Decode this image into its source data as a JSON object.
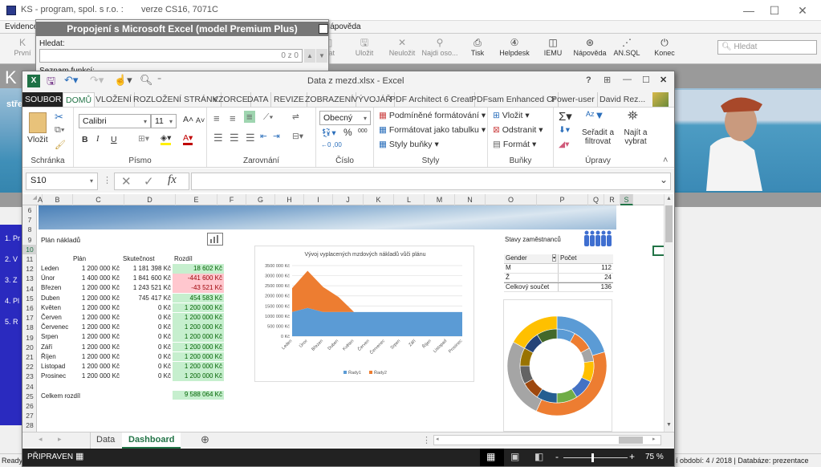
{
  "ks": {
    "title": "KS - program, spol. s r.o. :",
    "version": "verze CS16, 7071C",
    "menu": {
      "evidence": "Evidence",
      "napoveda": "Nápověda"
    },
    "toolbar": [
      {
        "label": "První",
        "icon": "first-icon"
      },
      {
        "label": "Uložit",
        "icon": "save-icon"
      },
      {
        "label": "Neuložit",
        "icon": "discard-icon"
      },
      {
        "label": "Najdi oso...",
        "icon": "search-person-icon"
      },
      {
        "label": "Tisk",
        "icon": "print-icon"
      },
      {
        "label": "Helpdesk",
        "icon": "helpdesk-icon"
      },
      {
        "label": "IEMU",
        "icon": "book-icon"
      },
      {
        "label": "Nápověda",
        "icon": "help-icon"
      },
      {
        "label": "AN.SQL",
        "icon": "sql-icon"
      },
      {
        "label": "Konec",
        "icon": "power-icon"
      }
    ],
    "partial_toolbar_label": "zat",
    "search_placeholder": "Hledat",
    "logo": "K",
    "banner_text": "stře",
    "nav_items": [
      "1. Pr",
      "2. V",
      "3. Z",
      "4. Pl",
      "5. R"
    ],
    "status_left": "Ready",
    "status_right": "í období: 4 / 2018 | Databáze: prezentace"
  },
  "popup": {
    "title": "Propojení s Microsoft Excel (model Premium Plus)",
    "search_label": "Hledat:",
    "search_counter": "0 z 0",
    "list_label": "Seznam funkcí:"
  },
  "excel": {
    "title": "Data z mezd.xlsx - Excel",
    "title_buttons": [
      "?",
      "⊞",
      "—",
      "☐",
      "✕"
    ],
    "tabs": [
      "SOUBOR",
      "DOMŮ",
      "VLOŽENÍ",
      "ROZLOŽENÍ STRÁNK",
      "VZORCE",
      "DATA",
      "REVIZE",
      "ZOBRAZENÍ",
      "VÝVOJÁŘ",
      "PDF Architect 6 Creat",
      "PDFsam Enhanced Cr",
      "Power-user"
    ],
    "active_tab": "DOMŮ",
    "user": "David Rez...",
    "ribbon": {
      "clipboard": {
        "paste": "Vložit",
        "group": "Schránka"
      },
      "font": {
        "name": "Calibri",
        "size": "11",
        "bold": "B",
        "italic": "I",
        "underline": "U",
        "group": "Písmo"
      },
      "alignment": {
        "group": "Zarovnání"
      },
      "number": {
        "format": "Obecný",
        "percent": "%",
        "thousands": "000",
        "group": "Číslo"
      },
      "styles": {
        "conditional": "Podmíněné formátování",
        "as_table": "Formátovat jako tabulku",
        "cell_styles": "Styly buňky",
        "group": "Styly"
      },
      "cells": {
        "insert": "Vložit",
        "delete": "Odstranit",
        "format": "Formát",
        "group": "Buňky"
      },
      "editing": {
        "sort": "Seřadit a filtrovat",
        "find": "Najít a vybrat",
        "group": "Úpravy"
      }
    },
    "name_box": "S10",
    "formula": "",
    "columns": [
      "A",
      "B",
      "C",
      "D",
      "E",
      "F",
      "G",
      "H",
      "I",
      "J",
      "K",
      "L",
      "M",
      "N",
      "O",
      "P",
      "Q",
      "R",
      "S"
    ],
    "rows": [
      "6",
      "7",
      "8",
      "9",
      "10",
      "11",
      "12",
      "13",
      "14",
      "15",
      "16",
      "17",
      "18",
      "19",
      "20",
      "21",
      "22",
      "23",
      "24",
      "25",
      "26",
      "27",
      "28"
    ],
    "plan_title": "Plán nákladů",
    "table_headers": [
      "Plán",
      "Skutečnost",
      "Rozdíl"
    ],
    "table_rows": [
      {
        "month": "Leden",
        "plan": "1 200 000 Kč",
        "actual": "1 181 398 Kč",
        "diff": "18 602 Kč",
        "status": "pos"
      },
      {
        "month": "Únor",
        "plan": "1 400 000 Kč",
        "actual": "1 841 600 Kč",
        "diff": "-441 600 Kč",
        "status": "neg"
      },
      {
        "month": "Březen",
        "plan": "1 200 000 Kč",
        "actual": "1 243 521 Kč",
        "diff": "-43 521 Kč",
        "status": "neg"
      },
      {
        "month": "Duben",
        "plan": "1 200 000 Kč",
        "actual": "745 417 Kč",
        "diff": "454 583 Kč",
        "status": "pos"
      },
      {
        "month": "Květen",
        "plan": "1 200 000 Kč",
        "actual": "0 Kč",
        "diff": "1 200 000 Kč",
        "status": "pos"
      },
      {
        "month": "Červen",
        "plan": "1 200 000 Kč",
        "actual": "0 Kč",
        "diff": "1 200 000 Kč",
        "status": "pos"
      },
      {
        "month": "Červenec",
        "plan": "1 200 000 Kč",
        "actual": "0 Kč",
        "diff": "1 200 000 Kč",
        "status": "pos"
      },
      {
        "month": "Srpen",
        "plan": "1 200 000 Kč",
        "actual": "0 Kč",
        "diff": "1 200 000 Kč",
        "status": "pos"
      },
      {
        "month": "Září",
        "plan": "1 200 000 Kč",
        "actual": "0 Kč",
        "diff": "1 200 000 Kč",
        "status": "pos"
      },
      {
        "month": "Říjen",
        "plan": "1 200 000 Kč",
        "actual": "0 Kč",
        "diff": "1 200 000 Kč",
        "status": "pos"
      },
      {
        "month": "Listopad",
        "plan": "1 200 000 Kč",
        "actual": "0 Kč",
        "diff": "1 200 000 Kč",
        "status": "pos"
      },
      {
        "month": "Prosinec",
        "plan": "1 200 000 Kč",
        "actual": "0 Kč",
        "diff": "1 200 000 Kč",
        "status": "pos"
      }
    ],
    "total_label": "Celkem rozdíl",
    "total_value": "9 588 064 Kč",
    "staff_title": "Stavy zaměstnanců",
    "pivot": {
      "headers": [
        "Gender",
        "Počet"
      ],
      "rows": [
        {
          "k": "M",
          "v": "112"
        },
        {
          "k": "Ž",
          "v": "24"
        },
        {
          "k": "Celkový součet",
          "v": "136"
        }
      ]
    },
    "sheet_tabs": [
      "Data",
      "Dashboard"
    ],
    "active_sheet": "Dashboard",
    "status": "PŘIPRAVEN",
    "zoom": "75 %",
    "zoom_level": 75
  },
  "chart_data": [
    {
      "type": "area",
      "title": "Vývoj vyplacených mzdových nákladů vůči plánu",
      "categories": [
        "Leden",
        "Únor",
        "Březen",
        "Duben",
        "Květen",
        "Červen",
        "Červenec",
        "Srpen",
        "Září",
        "Říjen",
        "Listopad",
        "Prosinec"
      ],
      "series": [
        {
          "name": "Řady1",
          "color": "#5b9bd5",
          "values": [
            1200000,
            1400000,
            1200000,
            1200000,
            1200000,
            1200000,
            1200000,
            1200000,
            1200000,
            1200000,
            1200000,
            1200000
          ]
        },
        {
          "name": "Řady2",
          "color": "#ed7d31",
          "values": [
            1181398,
            1841600,
            1243521,
            745417,
            0,
            0,
            0,
            0,
            0,
            0,
            0,
            0
          ]
        }
      ],
      "stacked": true,
      "y_ticks": [
        "0 Kč",
        "500 000 Kč",
        "1000 000 Kč",
        "1500 000 Kč",
        "2000 000 Kč",
        "2500 000 Kč",
        "3000 000 Kč",
        "3500 000 Kč"
      ],
      "ylim": [
        0,
        3500000
      ],
      "legend": "bottom",
      "grid": true
    },
    {
      "type": "pie",
      "variant": "doughnut",
      "title": "",
      "outer": [
        {
          "color": "#5b9bd5",
          "value": 18
        },
        {
          "color": "#ed7d31",
          "value": 32
        },
        {
          "color": "#a5a5a5",
          "value": 23
        },
        {
          "color": "#ffc000",
          "value": 15
        },
        {
          "color": "#5b9bd5",
          "value": 0
        }
      ],
      "inner": [
        {
          "color": "#5b9bd5",
          "value": 8
        },
        {
          "color": "#ed7d31",
          "value": 9
        },
        {
          "color": "#a5a5a5",
          "value": 6
        },
        {
          "color": "#ffc000",
          "value": 9
        },
        {
          "color": "#4472c4",
          "value": 9
        },
        {
          "color": "#70ad47",
          "value": 9
        },
        {
          "color": "#255e91",
          "value": 9
        },
        {
          "color": "#9e480e",
          "value": 8
        },
        {
          "color": "#636363",
          "value": 8
        },
        {
          "color": "#997300",
          "value": 8
        },
        {
          "color": "#264478",
          "value": 8
        },
        {
          "color": "#43682b",
          "value": 9
        }
      ]
    }
  ]
}
